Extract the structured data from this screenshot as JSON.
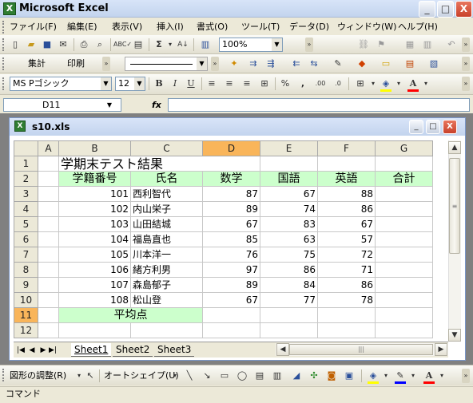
{
  "app": {
    "title": "Microsoft Excel",
    "icon": "excel-icon"
  },
  "window_controls": {
    "minimize": "_",
    "maximize": "□",
    "close": "X"
  },
  "menu": [
    "ファイル(F)",
    "編集(E)",
    "表示(V)",
    "挿入(I)",
    "書式(O)",
    "ツール(T)",
    "データ(D)",
    "ウィンドウ(W)",
    "ヘルプ(H)"
  ],
  "toolbar1": {
    "zoom": "100%"
  },
  "toolbar2": {
    "btn_sum": "集計",
    "btn_print": "印刷"
  },
  "format_toolbar": {
    "font_name": "MS Pゴシック",
    "font_size": "12",
    "bold": "B",
    "italic": "I",
    "underline": "U",
    "percent": "%",
    "comma": ",",
    "inc_decimal": ".00",
    "dec_decimal": ".0"
  },
  "formula_bar": {
    "name_box": "D11",
    "fx": "fx",
    "formula": ""
  },
  "workbook": {
    "title": "s10.xls"
  },
  "columns": [
    "A",
    "B",
    "C",
    "D",
    "E",
    "F",
    "G"
  ],
  "active_cell": {
    "column": "D",
    "row": "11"
  },
  "rows": [
    "1",
    "2",
    "3",
    "4",
    "5",
    "6",
    "7",
    "8",
    "9",
    "10",
    "11",
    "12"
  ],
  "sheet": {
    "title": "学期末テスト結果",
    "headers": [
      "学籍番号",
      "氏名",
      "数学",
      "国語",
      "英語",
      "合計"
    ],
    "records": [
      {
        "id": "101",
        "name": "西利智代",
        "math": "87",
        "japanese": "67",
        "english": "88"
      },
      {
        "id": "102",
        "name": "内山栄子",
        "math": "89",
        "japanese": "74",
        "english": "86"
      },
      {
        "id": "103",
        "name": "山田結城",
        "math": "67",
        "japanese": "83",
        "english": "67"
      },
      {
        "id": "104",
        "name": "福島直也",
        "math": "85",
        "japanese": "63",
        "english": "57"
      },
      {
        "id": "105",
        "name": "川本洋一",
        "math": "76",
        "japanese": "75",
        "english": "72"
      },
      {
        "id": "106",
        "name": "緒方利男",
        "math": "97",
        "japanese": "86",
        "english": "71"
      },
      {
        "id": "107",
        "name": "森島郁子",
        "math": "89",
        "japanese": "84",
        "english": "86"
      },
      {
        "id": "108",
        "name": "松山登",
        "math": "67",
        "japanese": "77",
        "english": "78"
      }
    ],
    "average_label": "平均点"
  },
  "tabs": [
    "Sheet1",
    "Sheet2",
    "Sheet3"
  ],
  "active_tab": "Sheet1",
  "drawing_toolbar": {
    "adjust": "図形の調整(R)",
    "autoshape": "オートシェイプ(U)"
  },
  "status": {
    "text": "コマンド"
  },
  "colors": {
    "header_fill": "#ccffcc",
    "active_header": "#f9b55a",
    "titlebar": "#c3d4ee"
  }
}
